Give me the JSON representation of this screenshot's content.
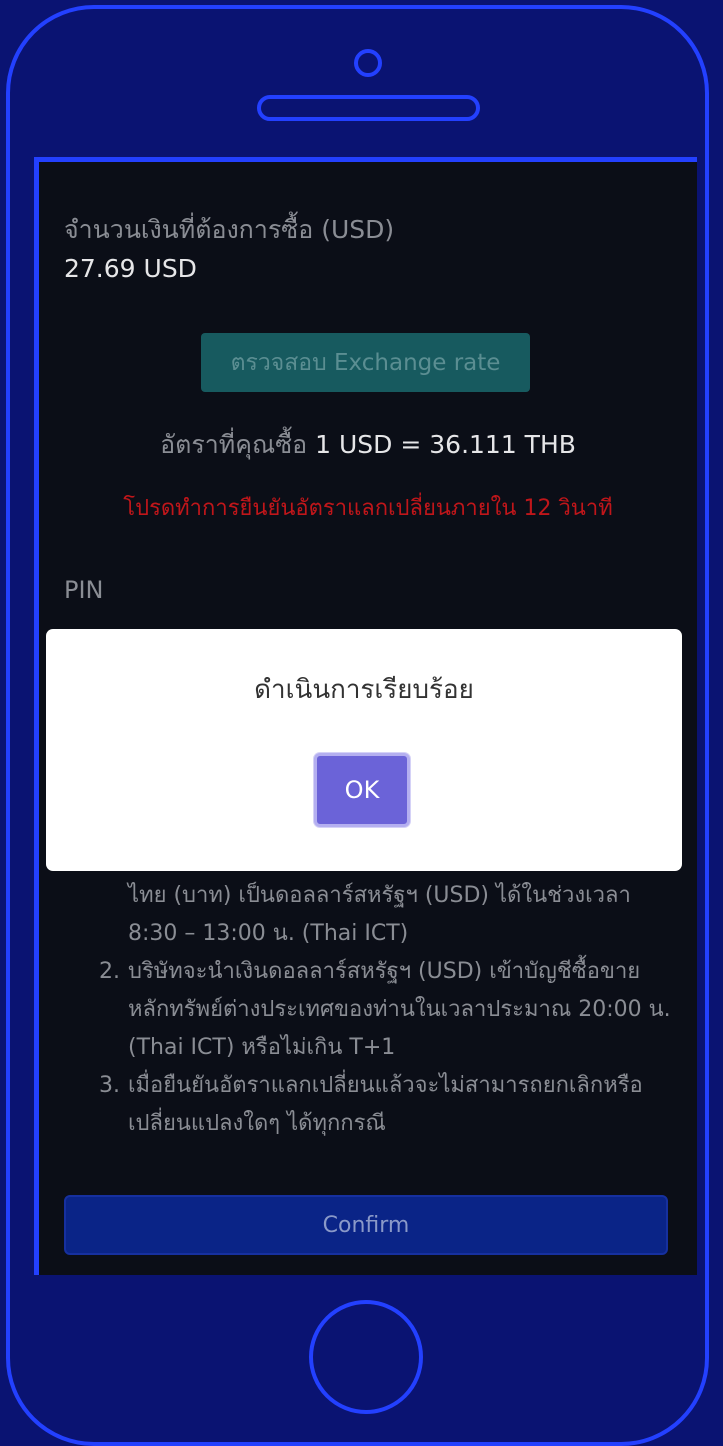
{
  "form": {
    "amount_label": "จำนวนเงินที่ต้องการซื้อ (USD)",
    "amount_value": "27.69 USD",
    "check_rate_button": "ตรวจสอบ Exchange rate",
    "rate_label": "อัตราที่คุณซื้อ",
    "rate_value": "1 USD = 36.111 THB",
    "confirm_warning": "โปรดทำการยืนยันอัตราแลกเปลี่ยนภายใน 12 วินาที",
    "pin_label": "PIN",
    "pin_value": "••••••",
    "notes": [
      {
        "num": "",
        "text": "ไทย (บาท) เป็นดอลลาร์สหรัฐฯ (USD) ได้ในช่วงเวลา 8:30 – 13:00 น. (Thai ICT)"
      },
      {
        "num": "2.",
        "text": "บริษัทจะนำเงินดอลลาร์สหรัฐฯ (USD) เข้าบัญชีซื้อขายหลักทรัพย์ต่างประเทศของท่านในเวลาประมาณ 20:00 น. (Thai ICT) หรือไม่เกิน T+1"
      },
      {
        "num": "3.",
        "text": "เมื่อยืนยันอัตราแลกเปลี่ยนแล้วจะไม่สามารถยกเลิกหรือเปลี่ยนแปลงใดๆ ได้ทุกกรณี"
      }
    ],
    "confirm_button": "Confirm"
  },
  "modal": {
    "message": "ดำเนินการเรียบร้อย",
    "ok_button": "OK"
  },
  "colors": {
    "frame": "#2340ff",
    "background": "#0a1372",
    "screen": "#0b0e17",
    "warning": "#c0161a",
    "ok_button": "#6b63d8"
  }
}
